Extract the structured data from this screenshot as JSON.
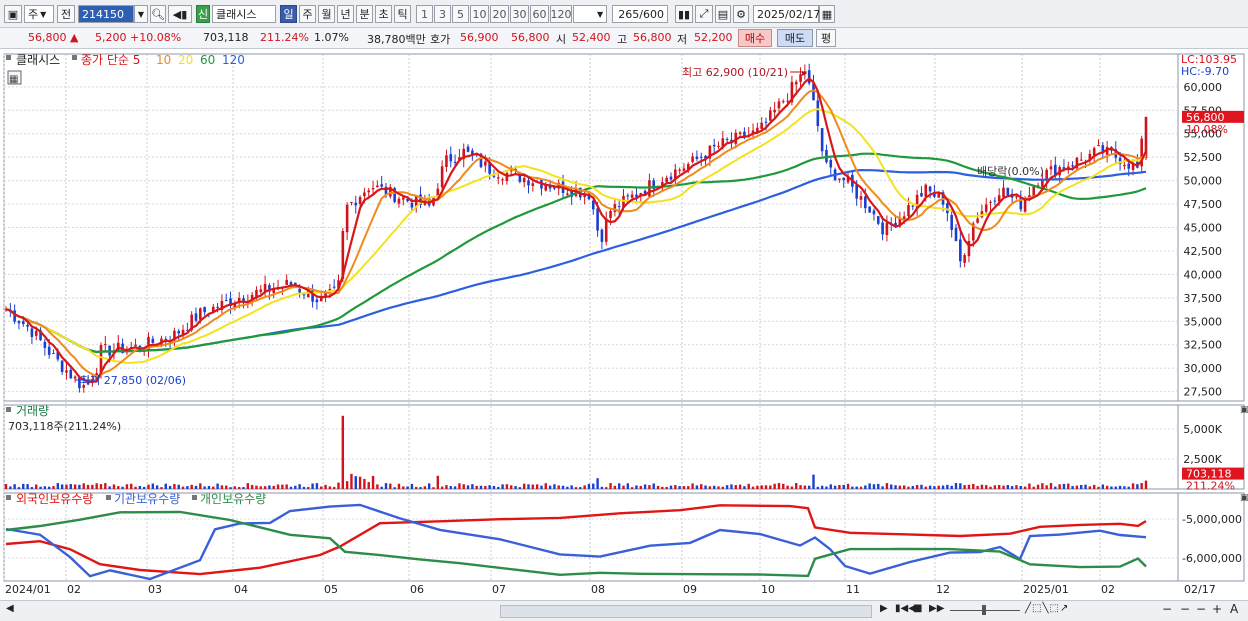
{
  "toolbar": {
    "market": "주",
    "prev_label": "전",
    "code": "214150",
    "new_badge": "신",
    "stock_name": "클래시스",
    "periods": [
      "일",
      "주",
      "월",
      "년",
      "분",
      "초",
      "틱"
    ],
    "active_period": "일",
    "intervals": [
      "1",
      "3",
      "5",
      "10",
      "20",
      "30",
      "60",
      "120"
    ],
    "count": "265",
    "max_count": "/600",
    "date": "2025/02/17"
  },
  "quote": {
    "price": "56,800 ▲",
    "change": "5,200 +10.08%",
    "volume": "703,118",
    "vol_ratio": "211.24%",
    "turnover": "1.07%",
    "amount": "38,780백만",
    "bid_label": "호가",
    "bid1": "56,900",
    "bid2": "56,800",
    "open_label": "시",
    "open": "52,400",
    "high_label": "고",
    "high": "56,800",
    "low_label": "저",
    "low": "52,200",
    "buy_label": "매수",
    "sell_label": "매도",
    "avg_label": "평"
  },
  "price_panel": {
    "title": "클래시스",
    "ma_title": "종가 단순 5",
    "ma_periods": [
      "10",
      "20",
      "60",
      "120"
    ],
    "lc": "LC:103.95",
    "hc": "HC:-9.70",
    "high_annotation": "최고 62,900 (10/21)",
    "low_annotation": "최저 27,850 (02/06)",
    "dividend_annotation": "배당락(0.0%)",
    "current_price": "56,800",
    "current_pct": "10.08%",
    "y_ticks": [
      "60,000",
      "57,500",
      "55,000",
      "52,500",
      "50,000",
      "47,500",
      "45,000",
      "42,500",
      "40,000",
      "37,500",
      "35,000",
      "32,500",
      "30,000",
      "27,500"
    ]
  },
  "volume_panel": {
    "title": "거래량",
    "value": "703,118주(211.24%)",
    "y_ticks": [
      "5,000K",
      "2,500K"
    ],
    "current": "703,118",
    "current_pct": "211.24%"
  },
  "holding_panel": {
    "legend": [
      "외국인보유수량",
      "기관보유수량",
      "개인보유수량"
    ],
    "y_ticks": [
      "-5,000,000",
      "-6,000,000"
    ]
  },
  "x_axis": [
    "2024/01",
    "02",
    "03",
    "04",
    "05",
    "06",
    "07",
    "08",
    "09",
    "10",
    "11",
    "12",
    "2025/01",
    "02",
    "02/17"
  ],
  "colors": {
    "up": "#d0141e",
    "down": "#1a3fcf",
    "ma5": "#d81818",
    "ma10": "#f08a1c",
    "ma20": "#f4e21c",
    "ma60": "#1f9a3a",
    "ma120": "#2e5fe0",
    "foreign": "#e01616",
    "institution": "#3a60d8",
    "individual": "#2e8c4a"
  },
  "chart_data": {
    "type": "candlestick",
    "title": "클래시스",
    "x_range": [
      "2024/01/02",
      "2025/02/17"
    ],
    "ylim": [
      26500,
      63500
    ],
    "close_ma_daily": "종가 단순 5,10,20,60,120",
    "monthly_close": [
      {
        "x": "2024/01",
        "close": 30000
      },
      {
        "x": "2024/02",
        "close": 31600
      },
      {
        "x": "2024/03",
        "close": 34000
      },
      {
        "x": "2024/04",
        "close": 37000
      },
      {
        "x": "2024/05",
        "close": 47600
      },
      {
        "x": "2024/06",
        "close": 51500
      },
      {
        "x": "2024/07",
        "close": 49000
      },
      {
        "x": "2024/08",
        "close": 48500
      },
      {
        "x": "2024/09",
        "close": 55000
      },
      {
        "x": "2024/10",
        "close": 52000
      },
      {
        "x": "2024/11",
        "close": 44500
      },
      {
        "x": "2024/12",
        "close": 47500
      },
      {
        "x": "2025/01",
        "close": 51500
      },
      {
        "x": "2025/02/17",
        "close": 56800
      }
    ],
    "high": {
      "date": "10/21",
      "value": 62900
    },
    "low": {
      "date": "02/06",
      "value": 27850
    },
    "last_candle": {
      "open": 52400,
      "high": 56800,
      "low": 52200,
      "close": 56800
    }
  }
}
